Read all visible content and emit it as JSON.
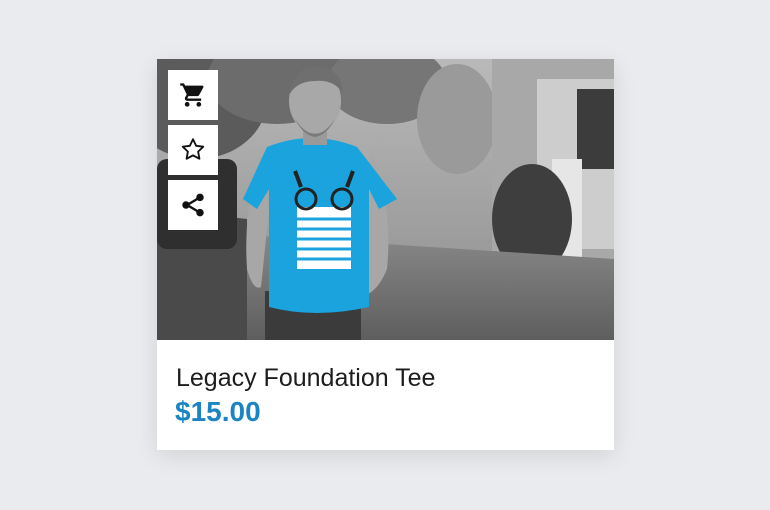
{
  "product": {
    "title": "Legacy Foundation Tee",
    "price": "$15.00",
    "image_alt": "Man walking on street wearing a blue t-shirt"
  },
  "actions": [
    {
      "name": "add-to-cart",
      "icon": "cart-icon"
    },
    {
      "name": "add-to-favorites",
      "icon": "star-icon"
    },
    {
      "name": "share",
      "icon": "share-icon"
    }
  ],
  "colors": {
    "price": "#1b84c2",
    "shirt": "#1aa3dc",
    "background": "#e9ebee",
    "card": "#ffffff"
  }
}
